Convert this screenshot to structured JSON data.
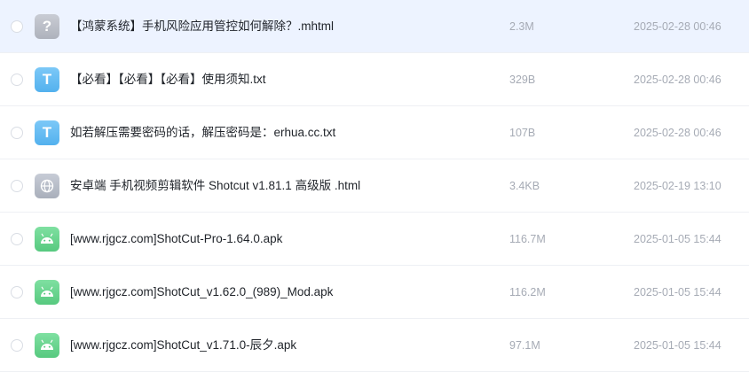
{
  "files": [
    {
      "name": "【鸿蒙系统】手机风险应用管控如何解除？.mhtml",
      "size": "2.3M",
      "date": "2025-02-28 00:46",
      "icon": "unknown-file-icon",
      "icon_glyph": "?"
    },
    {
      "name": "【必看】【必看】【必看】使用须知.txt",
      "size": "329B",
      "date": "2025-02-28 00:46",
      "icon": "text-file-icon",
      "icon_glyph": "T"
    },
    {
      "name": "如若解压需要密码的话，解压密码是：erhua.cc.txt",
      "size": "107B",
      "date": "2025-02-28 00:46",
      "icon": "text-file-icon",
      "icon_glyph": "T"
    },
    {
      "name": "安卓端 手机视频剪辑软件 Shotcut v1.81.1 高级版 .html",
      "size": "3.4KB",
      "date": "2025-02-19 13:10",
      "icon": "web-file-icon"
    },
    {
      "name": "[www.rjgcz.com]ShotCut-Pro-1.64.0.apk",
      "size": "116.7M",
      "date": "2025-01-05 15:44",
      "icon": "android-apk-icon"
    },
    {
      "name": "[www.rjgcz.com]ShotCut_v1.62.0_(989)_Mod.apk",
      "size": "116.2M",
      "date": "2025-01-05 15:44",
      "icon": "android-apk-icon"
    },
    {
      "name": "[www.rjgcz.com]ShotCut_v1.71.0-辰夕.apk",
      "size": "97.1M",
      "date": "2025-01-05 15:44",
      "icon": "android-apk-icon"
    }
  ]
}
